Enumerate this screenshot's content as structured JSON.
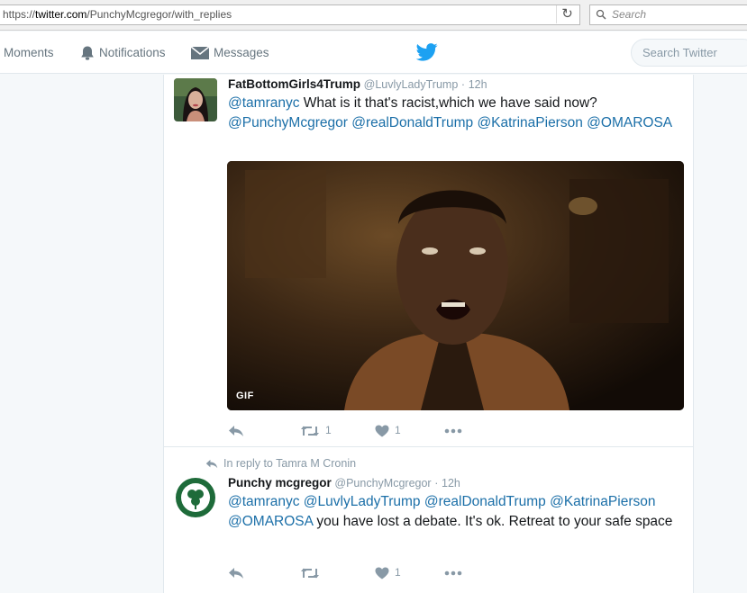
{
  "browser": {
    "url_scheme": "https://",
    "url_host": "twitter.com",
    "url_path": "/PunchyMcgregor/with_replies",
    "search_placeholder": "Search"
  },
  "nav": {
    "moments": "Moments",
    "notifications": "Notifications",
    "messages": "Messages",
    "search_placeholder": "Search Twitter"
  },
  "tweets": [
    {
      "fullname": "FatBottomGirls4Trump",
      "username": "@LuvlyLadyTrump",
      "separator": "·",
      "time": "12h",
      "text_parts": [
        {
          "t": "@tamranyc",
          "mention": true
        },
        {
          "t": " What is it that's racist,which we have said now? ",
          "mention": false
        },
        {
          "t": "@PunchyMcgregor",
          "mention": true
        },
        {
          "t": " ",
          "mention": false
        },
        {
          "t": "@realDonaldTrump",
          "mention": true
        },
        {
          "t": " ",
          "mention": false
        },
        {
          "t": "@KatrinaPierson",
          "mention": true
        },
        {
          "t": " ",
          "mention": false
        },
        {
          "t": "@OMAROSA",
          "mention": true
        }
      ],
      "media_badge": "GIF",
      "retweets": "1",
      "likes": "1"
    },
    {
      "reply_context": "In reply to Tamra M Cronin",
      "fullname": "Punchy mcgregor",
      "username": "@PunchyMcgregor",
      "separator": "·",
      "time": "12h",
      "text_parts": [
        {
          "t": "@tamranyc",
          "mention": true
        },
        {
          "t": " ",
          "mention": false
        },
        {
          "t": "@LuvlyLadyTrump",
          "mention": true
        },
        {
          "t": " ",
          "mention": false
        },
        {
          "t": "@realDonaldTrump",
          "mention": true
        },
        {
          "t": " ",
          "mention": false
        },
        {
          "t": "@KatrinaPierson",
          "mention": true
        },
        {
          "t": " ",
          "mention": false
        },
        {
          "t": "@OMAROSA",
          "mention": true
        },
        {
          "t": " you have lost a debate. It's ok. Retreat to your safe space",
          "mention": false
        }
      ],
      "retweets": "",
      "likes": "1"
    }
  ],
  "colors": {
    "mention": "#1b6fa8",
    "twitter_blue": "#1da1f2",
    "icon_gray": "#8899a6"
  }
}
